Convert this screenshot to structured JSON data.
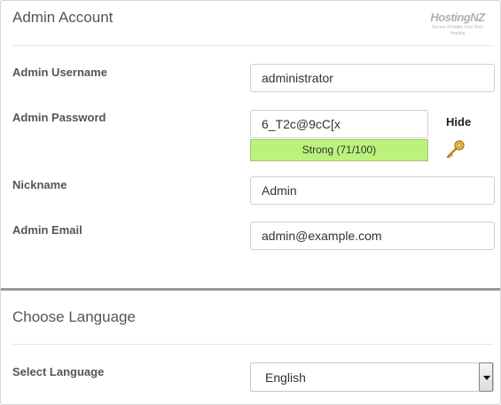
{
  "admin_account": {
    "title": "Admin Account",
    "logo_text": "HostingNZ",
    "logo_tagline": "Secure Reliable Fast Web Hosting",
    "username": {
      "label": "Admin Username",
      "value": "administrator"
    },
    "password": {
      "label": "Admin Password",
      "value": "6_T2c@9cC[x",
      "strength_text": "Strong (71/100)",
      "strength_score": 71,
      "toggle_label": "Hide",
      "generate_icon": "key-icon"
    },
    "nickname": {
      "label": "Nickname",
      "value": "Admin"
    },
    "email": {
      "label": "Admin Email",
      "value": "admin@example.com"
    }
  },
  "language": {
    "title": "Choose Language",
    "select_label": "Select Language",
    "selected": "English"
  },
  "colors": {
    "strength_bar": "#bbf27c",
    "section_divider": "#9a9a9a",
    "key_icon": "#d9a52c"
  }
}
